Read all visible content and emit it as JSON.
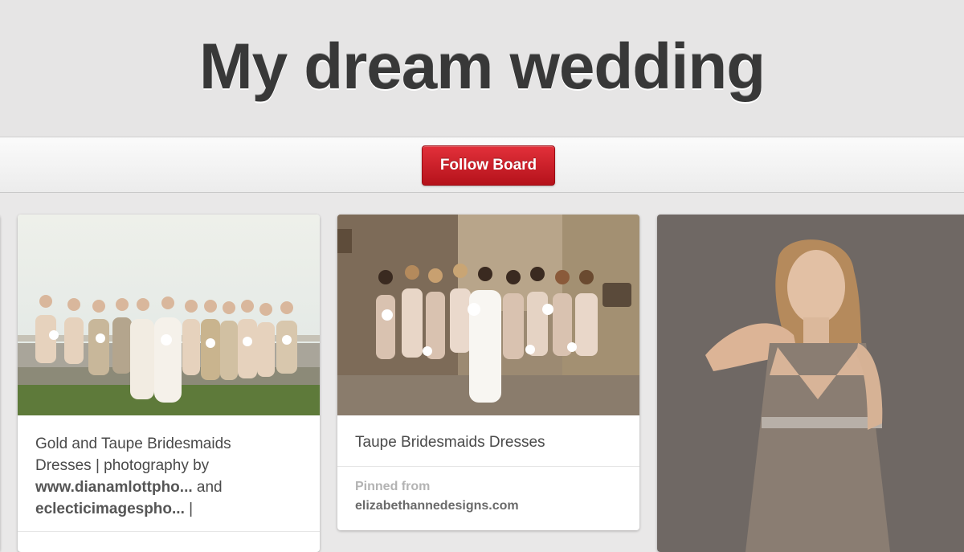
{
  "board": {
    "title": "My dream wedding",
    "follow_label": "Follow Board"
  },
  "pins": [
    {
      "description_line1": "Gold and Taupe Bridesmaids",
      "description_line2": "Dresses | photography by",
      "description_link1": "www.dianamlottpho...",
      "description_and": " and",
      "description_link2": "eclecticimagespho...",
      "description_end": " |"
    },
    {
      "description": "Taupe Bridesmaids Dresses",
      "pinned_from_label": "Pinned from",
      "pinned_from_source": "elizabethannedesigns.com"
    },
    {}
  ],
  "colors": {
    "follow_button": "#cb2027",
    "title_text": "#383838",
    "background": "#e9e8e8"
  }
}
